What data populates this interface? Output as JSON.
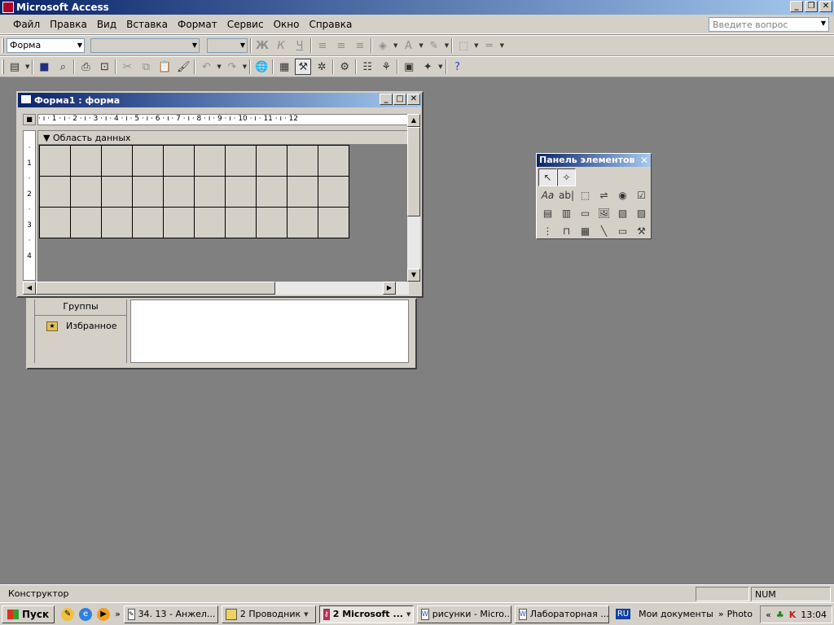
{
  "app": {
    "title": "Microsoft Access"
  },
  "menu": {
    "items": [
      "Файл",
      "Правка",
      "Вид",
      "Вставка",
      "Формат",
      "Сервис",
      "Окно",
      "Справка"
    ],
    "help_placeholder": "Введите вопрос"
  },
  "format_toolbar": {
    "object_combo": "Форма",
    "bold": "Ж",
    "italic": "К",
    "underline": "Ч"
  },
  "form_window": {
    "title": "Форма1 : форма",
    "section_label": "Область данных",
    "ruler_text": "· ı · 1 · ı · 2 · ı · 3 · ı · 4 · ı · 5 · ı · 6 · ı · 7 · ı · 8 · ı · 9 · ı · 10 · ı · 11 · ı · 12",
    "vruler": [
      "·",
      "1",
      "·",
      "2",
      "·",
      "3",
      "·",
      "4"
    ]
  },
  "db_window": {
    "groups_label": "Группы",
    "favorites_label": "Избранное"
  },
  "toolbox": {
    "title": "Панель элементов"
  },
  "status": {
    "mode": "Конструктор",
    "num": "NUM"
  },
  "taskbar": {
    "start": "Пуск",
    "tasks": [
      "34. 13 - Анжел...",
      "2 Проводник",
      "2 Microsoft ...",
      "рисунки - Micro...",
      "Лабораторная ..."
    ],
    "lang": "RU",
    "my_docs": "Мои документы",
    "photo": "Photo",
    "clock": "13:04"
  }
}
